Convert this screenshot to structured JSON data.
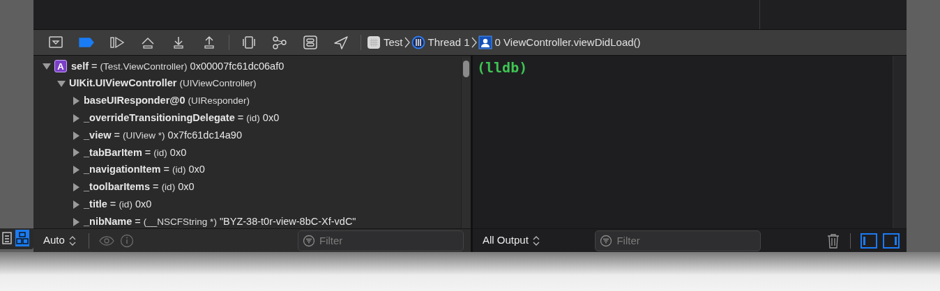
{
  "side_tabs": [
    {
      "kind": "inspector",
      "selected": false
    },
    {
      "kind": "layout",
      "selected": true
    }
  ],
  "debug_bar": {
    "buttons": [
      {
        "kind": "hide",
        "active": false
      },
      {
        "kind": "breakpoints",
        "active": true
      },
      {
        "kind": "continue",
        "active": false
      },
      {
        "kind": "step_over",
        "active": false
      },
      {
        "kind": "step_into",
        "active": false
      },
      {
        "kind": "step_out",
        "active": false
      },
      {
        "kind": "view_debug",
        "active": false
      },
      {
        "kind": "memory_graph",
        "active": false
      },
      {
        "kind": "environment",
        "active": false
      },
      {
        "kind": "location",
        "active": false
      }
    ],
    "breadcrumb": [
      {
        "kind": "app",
        "label": "Test"
      },
      {
        "kind": "thread",
        "label": "Thread 1"
      },
      {
        "kind": "frame",
        "label": "0 ViewController.viewDidLoad()"
      }
    ]
  },
  "variables": {
    "tree": [
      {
        "badge": "A",
        "name": "self",
        "equals": "=",
        "type": "(Test.ViewController)",
        "value": "0x00007fc61dc06af0",
        "expanded": true,
        "children": [
          {
            "name": "UIKit.UIViewController",
            "type": "(UIViewController)",
            "expanded": true,
            "children": [
              {
                "name": "baseUIResponder@0",
                "type": "(UIResponder)",
                "expanded": false
              },
              {
                "name": "_overrideTransitioningDelegate",
                "equals": "=",
                "type": "(id)",
                "value": "0x0",
                "expanded": false
              },
              {
                "name": "_view",
                "equals": "=",
                "type": "(UIView *)",
                "value": "0x7fc61dc14a90",
                "expanded": false
              },
              {
                "name": "_tabBarItem",
                "equals": "=",
                "type": "(id)",
                "value": "0x0",
                "expanded": false
              },
              {
                "name": "_navigationItem",
                "equals": "=",
                "type": "(id)",
                "value": "0x0",
                "expanded": false
              },
              {
                "name": "_toolbarItems",
                "equals": "=",
                "type": "(id)",
                "value": "0x0",
                "expanded": false
              },
              {
                "name": "_title",
                "equals": "=",
                "type": "(id)",
                "value": "0x0",
                "expanded": false
              },
              {
                "name": "_nibName",
                "equals": "=",
                "type": "(__NSCFString *)",
                "value": "\"BYZ-38-t0r-view-8bC-Xf-vdC\"",
                "expanded": false
              }
            ]
          }
        ]
      }
    ],
    "scope": "Auto",
    "filter": {
      "placeholder": "Filter"
    }
  },
  "console": {
    "prompt": "(lldb)",
    "output": "All Output",
    "filter": {
      "placeholder": "Filter"
    },
    "views": [
      {
        "kind": "variables",
        "selected": true
      },
      {
        "kind": "console",
        "selected": true
      }
    ]
  }
}
